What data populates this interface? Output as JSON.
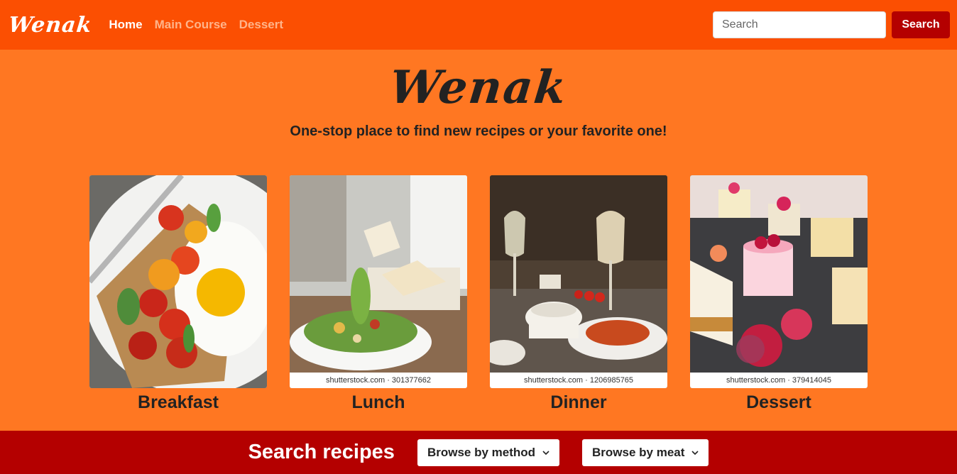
{
  "navbar": {
    "brand": "Wenak",
    "links": [
      "Home",
      "Main Course",
      "Dessert"
    ],
    "search": {
      "placeholder": "Search",
      "button_label": "Search"
    }
  },
  "hero": {
    "title": "Wenak",
    "tagline": "One-stop place to find new recipes or your favorite one!"
  },
  "cards": [
    {
      "title": "Breakfast",
      "watermark": ""
    },
    {
      "title": "Lunch",
      "watermark": "shutterstock.com · 301377662"
    },
    {
      "title": "Dinner",
      "watermark": "shutterstock.com · 1206985765"
    },
    {
      "title": "Dessert",
      "watermark": "shutterstock.com · 379414045"
    }
  ],
  "bottom": {
    "title": "Search recipes",
    "dropdowns": [
      "Browse by method",
      "Browse by meat"
    ]
  },
  "colors": {
    "navbar": "#fb4f02",
    "page": "#ff7722",
    "accent": "#b40000"
  }
}
